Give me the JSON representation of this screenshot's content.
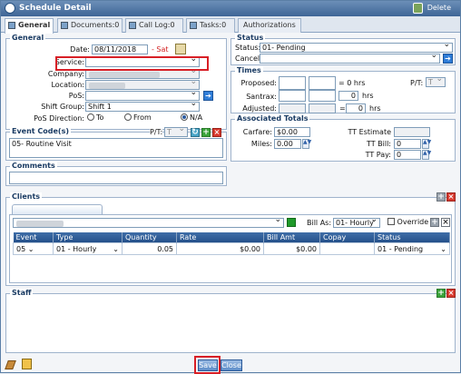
{
  "window": {
    "title": "Schedule Detail",
    "delete_label": "Delete"
  },
  "tabs": [
    {
      "label": "General"
    },
    {
      "label": "Documents:0"
    },
    {
      "label": "Call Log:0"
    },
    {
      "label": "Tasks:0"
    },
    {
      "label": "Authorizations"
    }
  ],
  "general": {
    "legend": "General",
    "date_label": "Date:",
    "date_value": "08/11/2018",
    "day": "- Sat",
    "service_label": "Service:",
    "company_label": "Company:",
    "location_label": "Location:",
    "pos_label": "PoS:",
    "shift_group_label": "Shift Group:",
    "shift_group_value": "Shift 1",
    "pos_direction_label": "PoS Direction:",
    "dir_to": "To",
    "dir_from": "From",
    "dir_na": "N/A",
    "event_codes_legend": "Event Code(s)",
    "pt_label": "P/T:",
    "pt_value": "T",
    "event_code_value": "05- Routine Visit",
    "comments_legend": "Comments"
  },
  "status": {
    "legend": "Status",
    "status_label": "Status:",
    "status_value": "01- Pending",
    "cancel_label": "Cancel:"
  },
  "times": {
    "legend": "Times",
    "proposed_label": "Proposed:",
    "proposed_hrs": "= 0 hrs",
    "pt_label": "P/T:",
    "pt_value": "T",
    "santrax_label": "Santrax:",
    "santrax_hrs": "0",
    "hrs": "hrs",
    "adjusted_label": "Adjusted:",
    "adjusted_eq": "=",
    "adjusted_hrs": "0"
  },
  "totals": {
    "legend": "Associated Totals",
    "carfare_label": "Carfare:",
    "carfare_value": "$0.00",
    "miles_label": "Miles:",
    "miles_value": "0.00",
    "tt_estimate_label": "TT Estimate",
    "tt_bill_label": "TT Bill:",
    "tt_bill_value": "0",
    "tt_pay_label": "TT Pay:",
    "tt_pay_value": "0"
  },
  "clients": {
    "legend": "Clients",
    "bill_as_label": "Bill As:",
    "bill_as_value": "01- Hourly",
    "override_label": "Override",
    "columns": [
      "Event",
      "Type",
      "Quantity",
      "Rate",
      "Bill Amt",
      "Copay",
      "Status"
    ],
    "rows": [
      {
        "event": "05",
        "type": "01 - Hourly",
        "quantity": "0.05",
        "rate": "$0.00",
        "bill_amt": "$0.00",
        "copay": "",
        "status": "01 - Pending"
      }
    ]
  },
  "staff": {
    "legend": "Staff"
  },
  "buttons": {
    "save": "Save",
    "close": "Close"
  },
  "colors": {
    "accent": "#2f7dd8",
    "highlight": "#d81f26",
    "add": "#3aa33a",
    "remove": "#d83a2e"
  }
}
